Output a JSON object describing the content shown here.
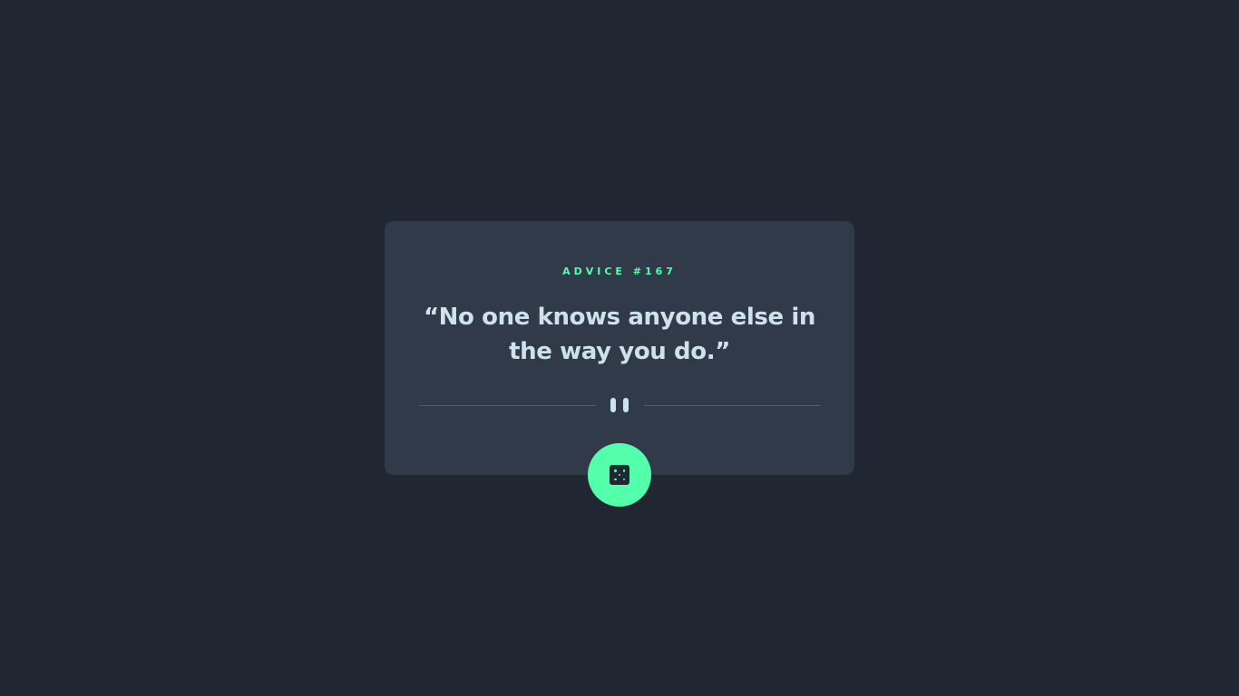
{
  "advice": {
    "label": "ADVICE #167",
    "quote": "“No one knows anyone else in the way you do.”"
  },
  "divider": {
    "icon": "pause-icon"
  },
  "button": {
    "icon": "dice-icon"
  },
  "colors": {
    "background": "#202632",
    "card": "#313a49",
    "accent": "#53ffaa",
    "text": "#cee3e9",
    "divider": "#4f5d74"
  }
}
